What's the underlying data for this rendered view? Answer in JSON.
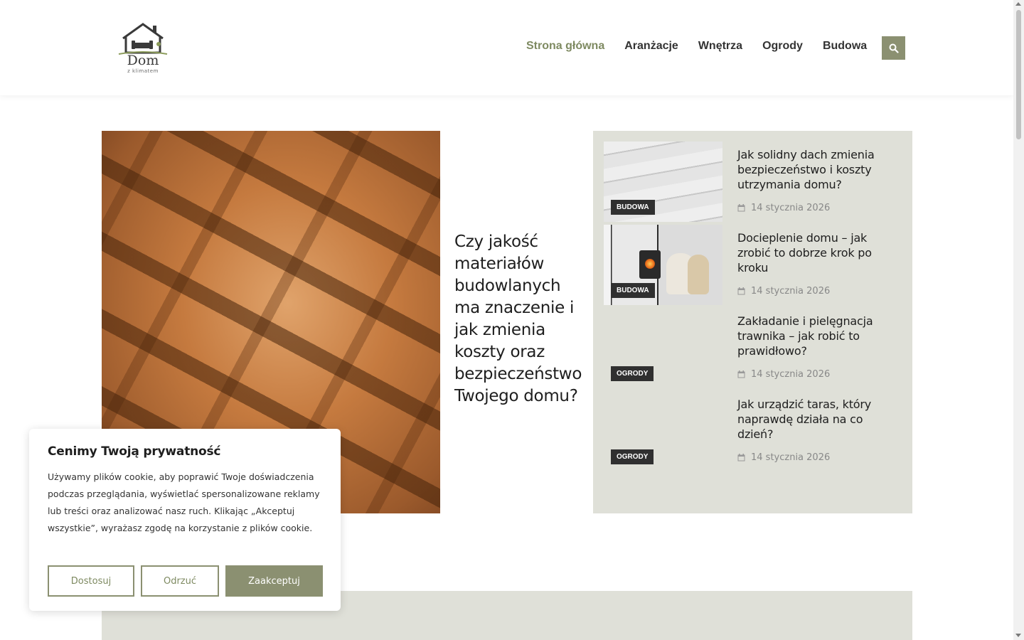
{
  "header": {
    "logo": {
      "title": "Dom",
      "subtitle": "z klimatem"
    },
    "nav": [
      {
        "label": "Strona główna",
        "active": true
      },
      {
        "label": "Aranżacje",
        "active": false
      },
      {
        "label": "Wnętrza",
        "active": false
      },
      {
        "label": "Ogrody",
        "active": false
      },
      {
        "label": "Budowa",
        "active": false
      }
    ],
    "search_icon": "search-icon"
  },
  "featured": {
    "title": "Czy jakość materiałów budowlanych ma znaczenie i jak zmienia koszty oraz bezpieczeństwo Twojego domu?"
  },
  "posts": [
    {
      "category": "BUDOWA",
      "title": "Jak solidny dach zmienia bezpieczeństwo i koszty utrzymania domu?",
      "date": "14 stycznia 2026"
    },
    {
      "category": "BUDOWA",
      "title": "Docieplenie domu – jak zrobić to dobrze krok po kroku",
      "date": "14 stycznia 2026"
    },
    {
      "category": "OGRODY",
      "title": "Zakładanie i pielęgnacja trawnika – jak robić to prawidłowo?",
      "date": "14 stycznia 2026"
    },
    {
      "category": "OGRODY",
      "title": "Jak urządzić taras, który naprawdę działa na co dzień?",
      "date": "14 stycznia 2026"
    }
  ],
  "cookie": {
    "title": "Cenimy Twoją prywatność",
    "text": "Używamy plików cookie, aby poprawić Twoje doświadczenia podczas przeglądania, wyświetlać spersonalizowane reklamy lub treści oraz analizować nasz ruch. Klikając „Akceptuj wszystkie”, wyrażasz zgodę na korzystanie z plików cookie.",
    "customize_label": "Dostosuj",
    "reject_label": "Odrzuć",
    "accept_label": "Zaakceptuj"
  },
  "colors": {
    "accent": "#8b9071",
    "nav_active": "#7e8a61",
    "panel_bg": "#dfe0d8",
    "badge_bg": "#303030"
  }
}
